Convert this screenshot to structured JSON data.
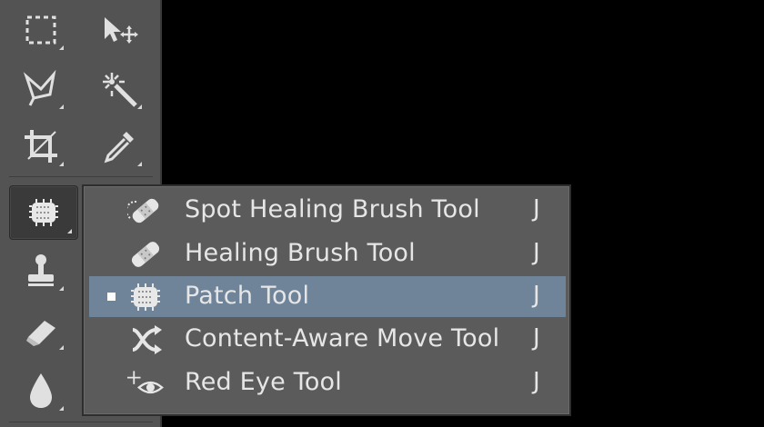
{
  "toolbar": {
    "tools": [
      {
        "name": "rectangular-marquee-tool"
      },
      {
        "name": "move-tool"
      },
      {
        "name": "polygonal-lasso-tool"
      },
      {
        "name": "magic-wand-tool"
      },
      {
        "name": "crop-tool"
      },
      {
        "name": "eyedropper-tool"
      },
      {
        "name": "patch-tool",
        "active": true
      },
      {
        "name": "clone-stamp-tool"
      },
      {
        "name": "eraser-tool"
      },
      {
        "name": "blur-tool"
      }
    ]
  },
  "flyout": {
    "items": [
      {
        "label": "Spot Healing Brush Tool",
        "shortcut": "J",
        "icon": "spot-healing-brush-icon",
        "selected": false
      },
      {
        "label": "Healing Brush Tool",
        "shortcut": "J",
        "icon": "healing-brush-icon",
        "selected": false
      },
      {
        "label": "Patch Tool",
        "shortcut": "J",
        "icon": "patch-icon",
        "selected": true
      },
      {
        "label": "Content-Aware Move Tool",
        "shortcut": "J",
        "icon": "content-aware-move-icon",
        "selected": false
      },
      {
        "label": "Red Eye Tool",
        "shortcut": "J",
        "icon": "red-eye-icon",
        "selected": false
      }
    ],
    "selected_color": "#6f8399"
  }
}
